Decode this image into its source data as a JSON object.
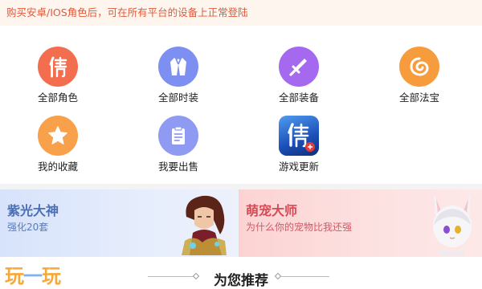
{
  "notice": {
    "text": "购买安卓/IOS角色后，可在所有平台的设备上正常登陆"
  },
  "categories": [
    {
      "label": "全部角色",
      "icon": "character-glyph-icon",
      "color": "#f26e4f"
    },
    {
      "label": "全部时装",
      "icon": "costume-icon",
      "color": "#7d8ff0"
    },
    {
      "label": "全部装备",
      "icon": "sword-icon",
      "color": "#a569f0"
    },
    {
      "label": "全部法宝",
      "icon": "magic-treasure-icon",
      "color": "#f79c3c"
    },
    {
      "label": "我的收藏",
      "icon": "star-icon",
      "color": "#f8a04a"
    },
    {
      "label": "我要出售",
      "icon": "clipboard-icon",
      "color": "#8f9af2"
    },
    {
      "label": "游戏更新",
      "icon": "game-app-icon",
      "color": "#2a6fd6"
    }
  ],
  "banners": {
    "left": {
      "title": "紫光大神",
      "subtitle": "强化20套"
    },
    "right": {
      "title": "萌宠大师",
      "subtitle": "为什么你的宠物比我还强"
    }
  },
  "footer": {
    "logo_a": "玩",
    "logo_b": "一",
    "logo_c": "玩",
    "recommend_title": "为您推荐"
  }
}
